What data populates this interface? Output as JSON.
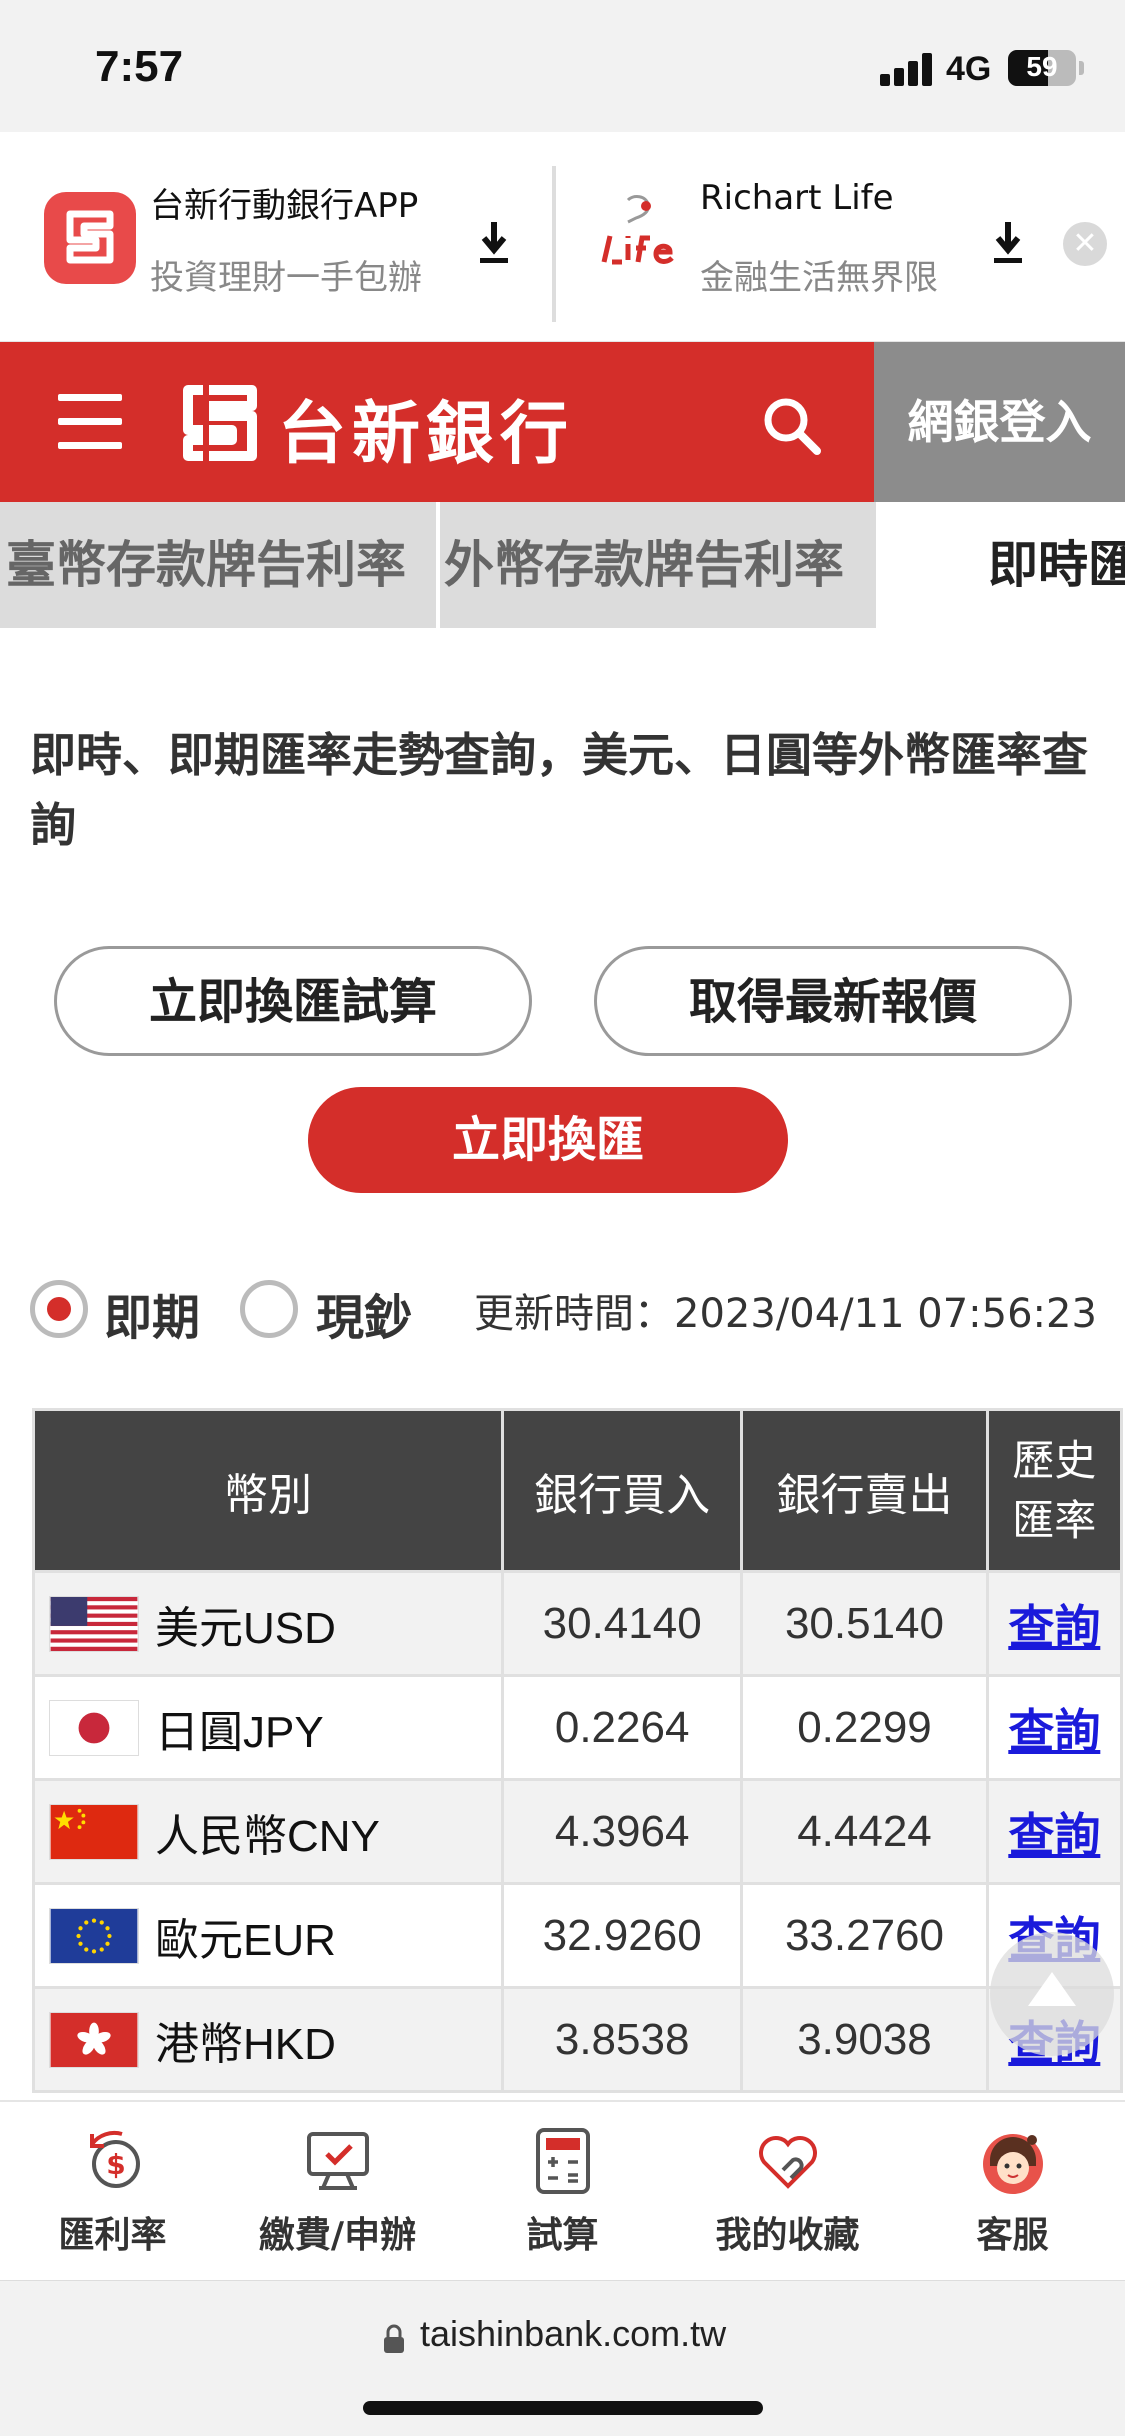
{
  "status_bar": {
    "time": "7:57",
    "network": "4G",
    "battery": "59",
    "battery_level": 0.59
  },
  "app_banner": {
    "apps": [
      {
        "title": "台新行動銀行APP",
        "subtitle": "投資理財一手包辦",
        "icon": "taishin-app-icon"
      },
      {
        "title": "Richart Life",
        "subtitle": "金融生活無界限",
        "icon": "richart-life-icon"
      }
    ],
    "close_icon": "close-icon"
  },
  "header": {
    "brand_name": "台新銀行",
    "login_label": "網銀登入"
  },
  "tabs": [
    {
      "label": "臺幣存款牌告利率"
    },
    {
      "label": "外幣存款牌告利率"
    },
    {
      "label": "即時匯率"
    }
  ],
  "description": "即時、即期匯率走勢查詢，美元、日圓等外幣匯率查詢",
  "buttons": {
    "calc": "立即換匯試算",
    "latest": "取得最新報價",
    "exchange": "立即換匯"
  },
  "rate_type": {
    "spot_label": "即期",
    "cash_label": "現鈔",
    "selected": "即期"
  },
  "update_time": "更新時間：2023/04/11 07:56:23",
  "table": {
    "headers": [
      "幣別",
      "銀行買入",
      "銀行賣出",
      "歷史匯率"
    ],
    "rows": [
      {
        "flag": "us-flag",
        "currency": "美元USD",
        "buy": "30.4140",
        "sell": "30.5140",
        "link": "查詢"
      },
      {
        "flag": "jp-flag",
        "currency": "日圓JPY",
        "buy": "0.2264",
        "sell": "0.2299",
        "link": "查詢"
      },
      {
        "flag": "cn-flag",
        "currency": "人民幣CNY",
        "buy": "4.3964",
        "sell": "4.4424",
        "link": "查詢"
      },
      {
        "flag": "eu-flag",
        "currency": "歐元EUR",
        "buy": "32.9260",
        "sell": "33.2760",
        "link": "查詢"
      },
      {
        "flag": "hk-flag",
        "currency": "港幣HKD",
        "buy": "3.8538",
        "sell": "3.9038",
        "link": "查詢"
      }
    ]
  },
  "bottom_nav": [
    {
      "label": "匯利率",
      "icon": "exchange-rate-icon"
    },
    {
      "label": "繳費/申辦",
      "icon": "payment-icon"
    },
    {
      "label": "試算",
      "icon": "calculator-icon"
    },
    {
      "label": "我的收藏",
      "icon": "favorites-icon"
    },
    {
      "label": "客服",
      "icon": "customer-service-icon"
    }
  ],
  "browser": {
    "url": "taishinbank.com.tw"
  },
  "colors": {
    "brand_red": "#d42e2a",
    "header_gray": "#8c8c8c",
    "link_blue": "#1a1adb",
    "table_header": "#444444"
  }
}
